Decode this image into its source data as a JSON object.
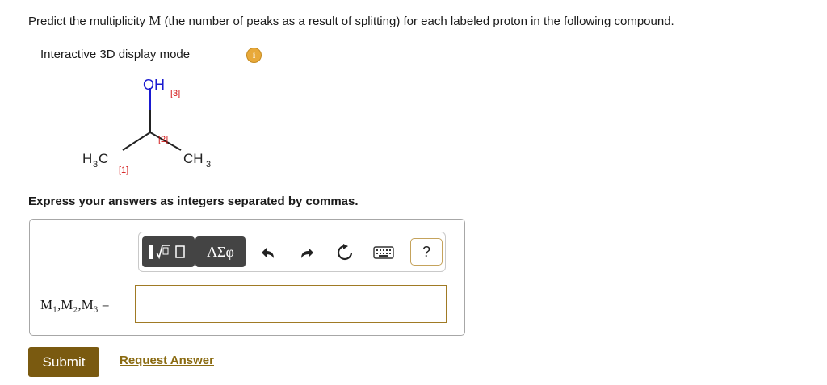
{
  "question": {
    "prefix": "Predict the multiplicity ",
    "symbol": "M",
    "suffix": " (the number of peaks as a result of splitting) for each labeled proton in the following compound."
  },
  "display_mode": {
    "label": "Interactive 3D display mode",
    "info_icon": "i"
  },
  "molecule": {
    "oh": "OH",
    "label_3": "[3]",
    "label_2": "[2]",
    "label_1": "[1]",
    "left_group_h": "H",
    "left_group_sub": "3",
    "left_group_c": "C",
    "right_group_ch": "CH",
    "right_group_sub": "3"
  },
  "instructions": "Express your answers as integers separated by commas.",
  "toolbar": {
    "templates_icon": "templates-icon",
    "symbols_label": "ΑΣφ",
    "undo_icon": "undo-icon",
    "redo_icon": "redo-icon",
    "reset_icon": "reset-icon",
    "keyboard_icon": "keyboard-icon",
    "help_label": "?"
  },
  "answer": {
    "label": "M₁,M₂,M₃ =",
    "value": ""
  },
  "buttons": {
    "submit": "Submit",
    "request_answer": "Request Answer"
  },
  "colors": {
    "oxygen": "#1a1ad0",
    "label": "#d21414",
    "submit_bg": "#7a5a10",
    "link": "#8a6a10"
  }
}
